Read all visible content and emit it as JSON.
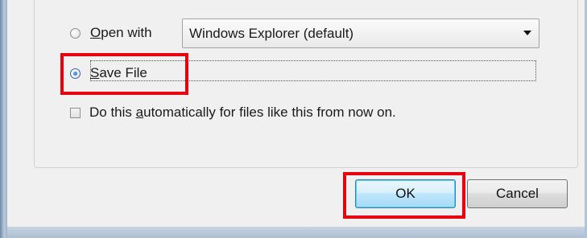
{
  "options": {
    "open_with_label_pre": "",
    "open_with_label_ul": "O",
    "open_with_label_post": "pen with",
    "open_with_selected": false,
    "save_file_label_ul": "S",
    "save_file_label_post": "ave File",
    "save_file_selected": true
  },
  "app_select": {
    "value": "Windows Explorer (default)"
  },
  "auto_checkbox": {
    "label_pre": "Do this ",
    "label_ul": "a",
    "label_post": "utomatically for files like this from now on.",
    "checked": false
  },
  "buttons": {
    "ok_label": "OK",
    "cancel_label": "Cancel"
  },
  "colors": {
    "highlight": "#e8000f",
    "accent": "#2e6ab1"
  }
}
